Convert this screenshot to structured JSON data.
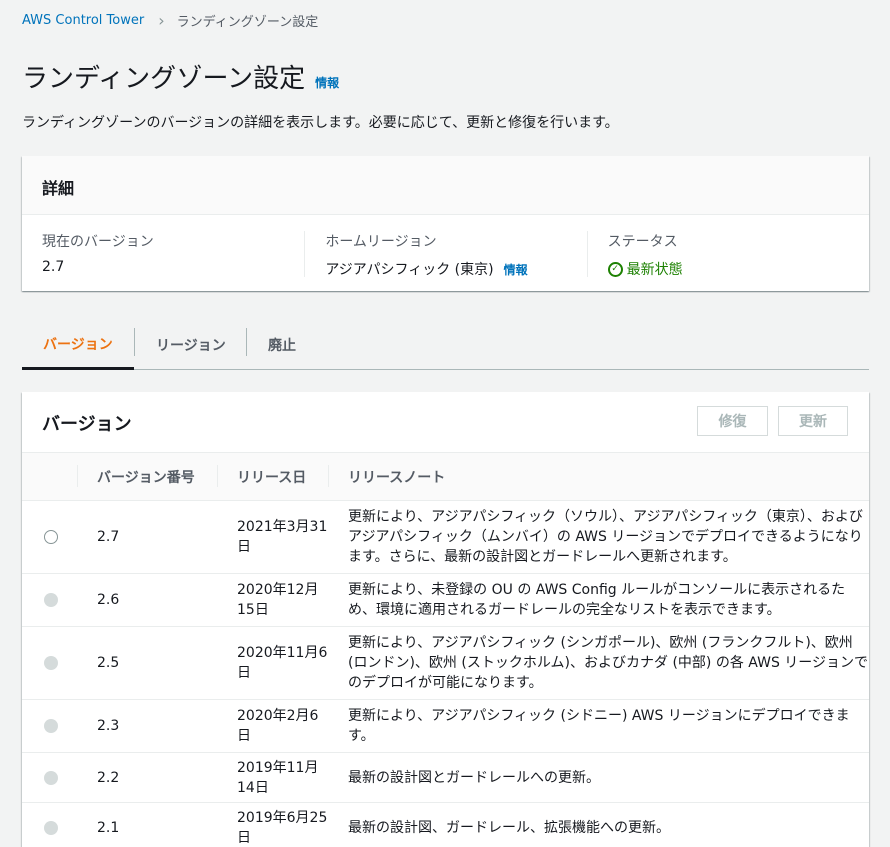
{
  "breadcrumb": {
    "root": "AWS Control Tower",
    "current": "ランディングゾーン設定"
  },
  "header": {
    "title": "ランディングゾーン設定",
    "info": "情報",
    "description": "ランディングゾーンのバージョンの詳細を表示します。必要に応じて、更新と修復を行います。"
  },
  "details": {
    "title": "詳細",
    "current_version_label": "現在のバージョン",
    "current_version": "2.7",
    "home_region_label": "ホームリージョン",
    "home_region": "アジアパシフィック (東京)",
    "home_region_info": "情報",
    "status_label": "ステータス",
    "status": "最新状態",
    "status_color": "#1d8102"
  },
  "tabs": [
    {
      "label": "バージョン",
      "active": true
    },
    {
      "label": "リージョン",
      "active": false
    },
    {
      "label": "廃止",
      "active": false
    }
  ],
  "versions": {
    "title": "バージョン",
    "repair_label": "修復",
    "update_label": "更新",
    "columns": {
      "version": "バージョン番号",
      "release_date": "リリース日",
      "notes": "リリースノート"
    },
    "rows": [
      {
        "version": "2.7",
        "date": "2021年3月31日",
        "notes": "更新により、アジアパシフィック（ソウル）、アジアパシフィック（東京）、およびアジアパシフィック（ムンバイ）の AWS リージョンでデプロイできるようになります。さらに、最新の設計図とガードレールへ更新されます。",
        "selectable": true
      },
      {
        "version": "2.6",
        "date": "2020年12月15日",
        "notes": "更新により、未登録の OU の AWS Config ルールがコンソールに表示されるため、環境に適用されるガードレールの完全なリストを表示できます。",
        "selectable": false
      },
      {
        "version": "2.5",
        "date": "2020年11月6日",
        "notes": "更新により、アジアパシフィック (シンガポール)、欧州 (フランクフルト)、欧州 (ロンドン)、欧州 (ストックホルム)、およびカナダ (中部) の各 AWS リージョンでのデプロイが可能になります。",
        "selectable": false
      },
      {
        "version": "2.3",
        "date": "2020年2月6日",
        "notes": "更新により、アジアパシフィック (シドニー) AWS リージョンにデプロイできます。",
        "selectable": false
      },
      {
        "version": "2.2",
        "date": "2019年11月14日",
        "notes": "最新の設計図とガードレールへの更新。",
        "selectable": false
      },
      {
        "version": "2.1",
        "date": "2019年6月25日",
        "notes": "最新の設計図、ガードレール、拡張機能への更新。",
        "selectable": false
      }
    ]
  }
}
